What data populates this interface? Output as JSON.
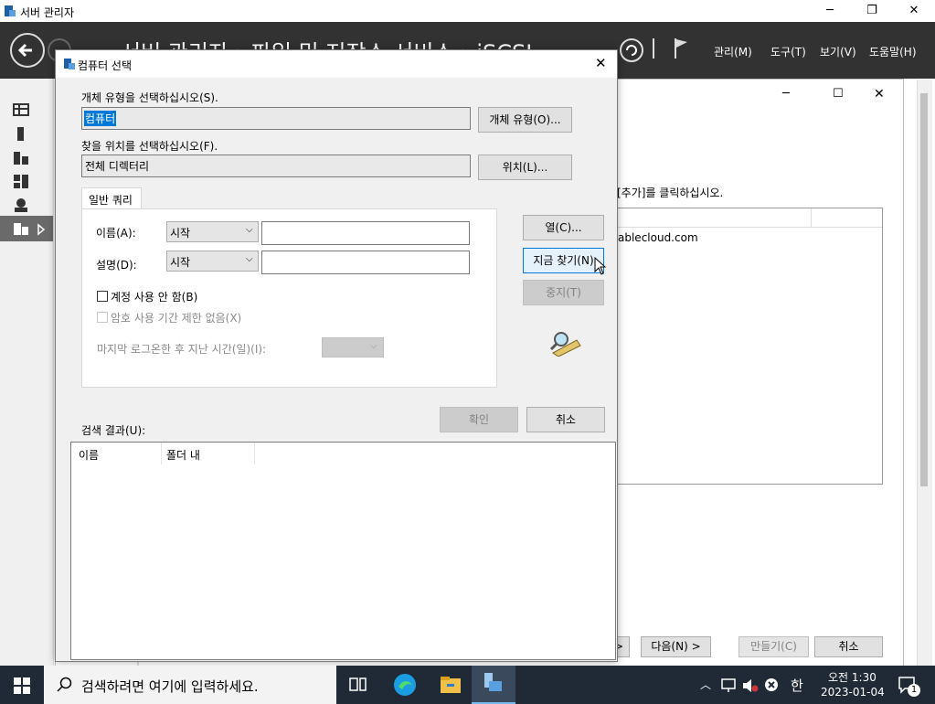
{
  "window": {
    "title": "서버 관리자"
  },
  "header": {
    "breadcrumb": "서버 관리자 › 파일 및 저장소 서비스 › iSCSI",
    "menu": [
      "관리(M)",
      "도구(T)",
      "보기(V)",
      "도움말(H)"
    ]
  },
  "wizard": {
    "instruction": "[추가]를 클릭하십시오.",
    "list_item": "ablecloud.com",
    "buttons": {
      "prev": "< 이전(P)",
      "next": "다음(N) >",
      "create": "만들기(C)",
      "cancel": "취소"
    }
  },
  "dialog": {
    "title": "컴퓨터 선택",
    "object_type_label": "개체 유형을 선택하십시오(S).",
    "object_type_value": "컴퓨터",
    "object_type_button": "개체 유형(O)...",
    "location_label": "찾을 위치를 선택하십시오(F).",
    "location_value": "전체 디렉터리",
    "location_button": "위치(L)...",
    "tab": "일반 쿼리",
    "name_label": "이름(A):",
    "name_op": "시작",
    "desc_label": "설명(D):",
    "desc_op": "시작",
    "disabled_accounts": "계정 사용 안 함(B)",
    "non_expiring": "암호 사용 기간 제한 없음(X)",
    "days_since_logon": "마지막 로그온한 후 지난 시간(일)(I):",
    "columns_button": "열(C)...",
    "find_now_button": "지금 찾기(N)",
    "stop_button": "중지(T)",
    "ok_button": "확인",
    "cancel_button": "취소",
    "results_label": "검색 결과(U):",
    "results_columns": [
      "이름",
      "폴더 내"
    ]
  },
  "taskbar": {
    "search_placeholder": "검색하려면 여기에 입력하세요.",
    "time": "오전 1:30",
    "date": "2023-01-04",
    "ime": "한",
    "notification_count": "1"
  }
}
